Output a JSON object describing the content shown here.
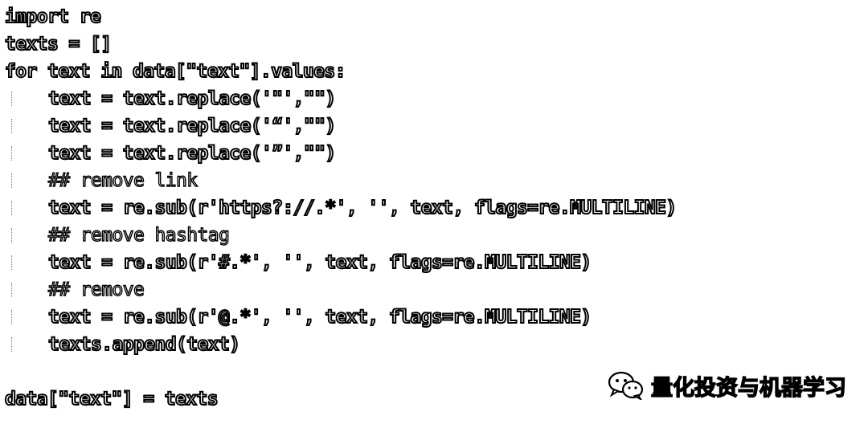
{
  "code": {
    "lines": [
      "import re",
      "texts = []",
      "for text in data[\"text\"].values:",
      "text = text.replace('\"',\"\")",
      "text = text.replace('“',\"\")",
      "text = text.replace('”',\"\")",
      "## remove link",
      "text = re.sub(r'https?://.*', '', text, flags=re.MULTILINE)",
      "## remove hashtag",
      "text = re.sub(r'#.*', '', text, flags=re.MULTILINE)",
      "## remove",
      "text = re.sub(r'@.*', '', text, flags=re.MULTILINE)",
      "texts.append(text)",
      "",
      "data[\"text\"] = texts"
    ]
  },
  "watermark": {
    "icon": "wechat-icon",
    "text": "量化投资与机器学习"
  }
}
